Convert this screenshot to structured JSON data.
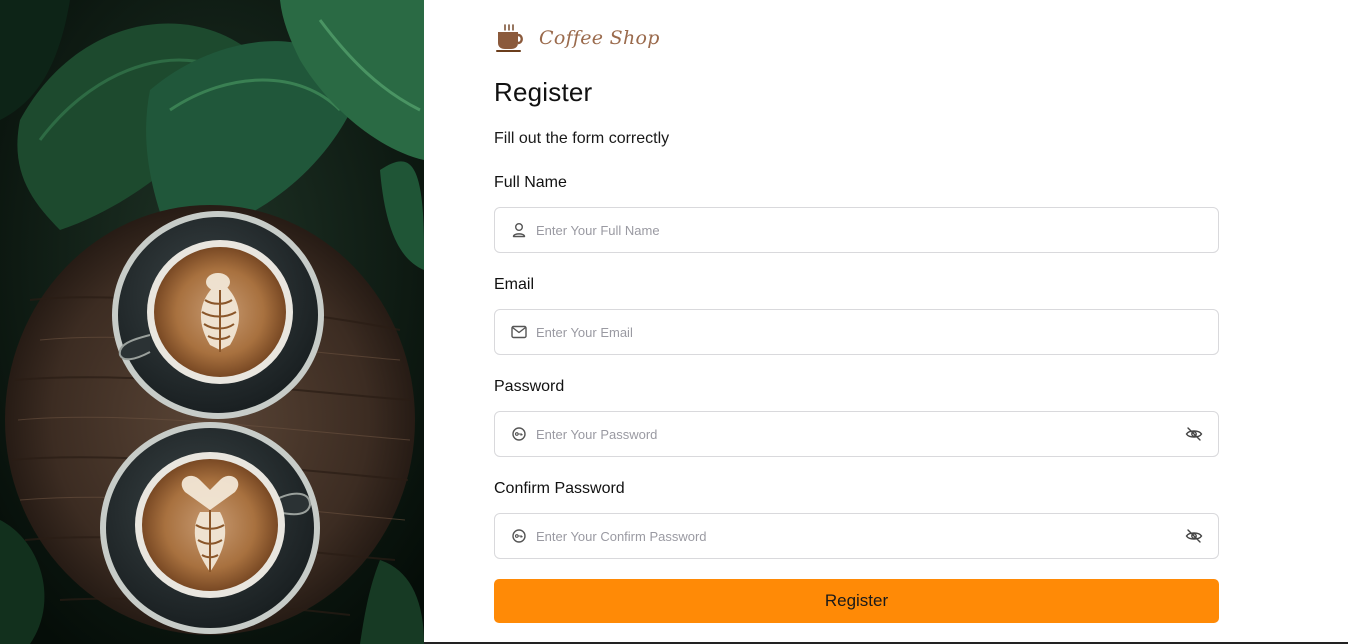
{
  "brand": {
    "name": "Coffee Shop",
    "icon": "coffee-cup-icon",
    "color": "#8b5a3c"
  },
  "heading": {
    "title": "Register",
    "subtitle": "Fill out the form correctly"
  },
  "form": {
    "full_name": {
      "label": "Full Name",
      "placeholder": "Enter Your Full Name",
      "value": "",
      "icon": "user-icon"
    },
    "email": {
      "label": "Email",
      "placeholder": "Enter Your Email",
      "value": "",
      "icon": "mail-icon"
    },
    "password": {
      "label": "Password",
      "placeholder": "Enter Your Password",
      "value": "",
      "icon": "key-icon",
      "toggle_icon": "eye-off-icon"
    },
    "confirm_password": {
      "label": "Confirm Password",
      "placeholder": "Enter Your Confirm Password",
      "value": "",
      "icon": "key-icon",
      "toggle_icon": "eye-off-icon"
    },
    "submit_label": "Register"
  },
  "colors": {
    "accent": "#ff8a06",
    "border": "#d9d9dc",
    "placeholder": "#9a9aa2"
  },
  "hero": {
    "description_icon": "coffee-latte-image"
  }
}
